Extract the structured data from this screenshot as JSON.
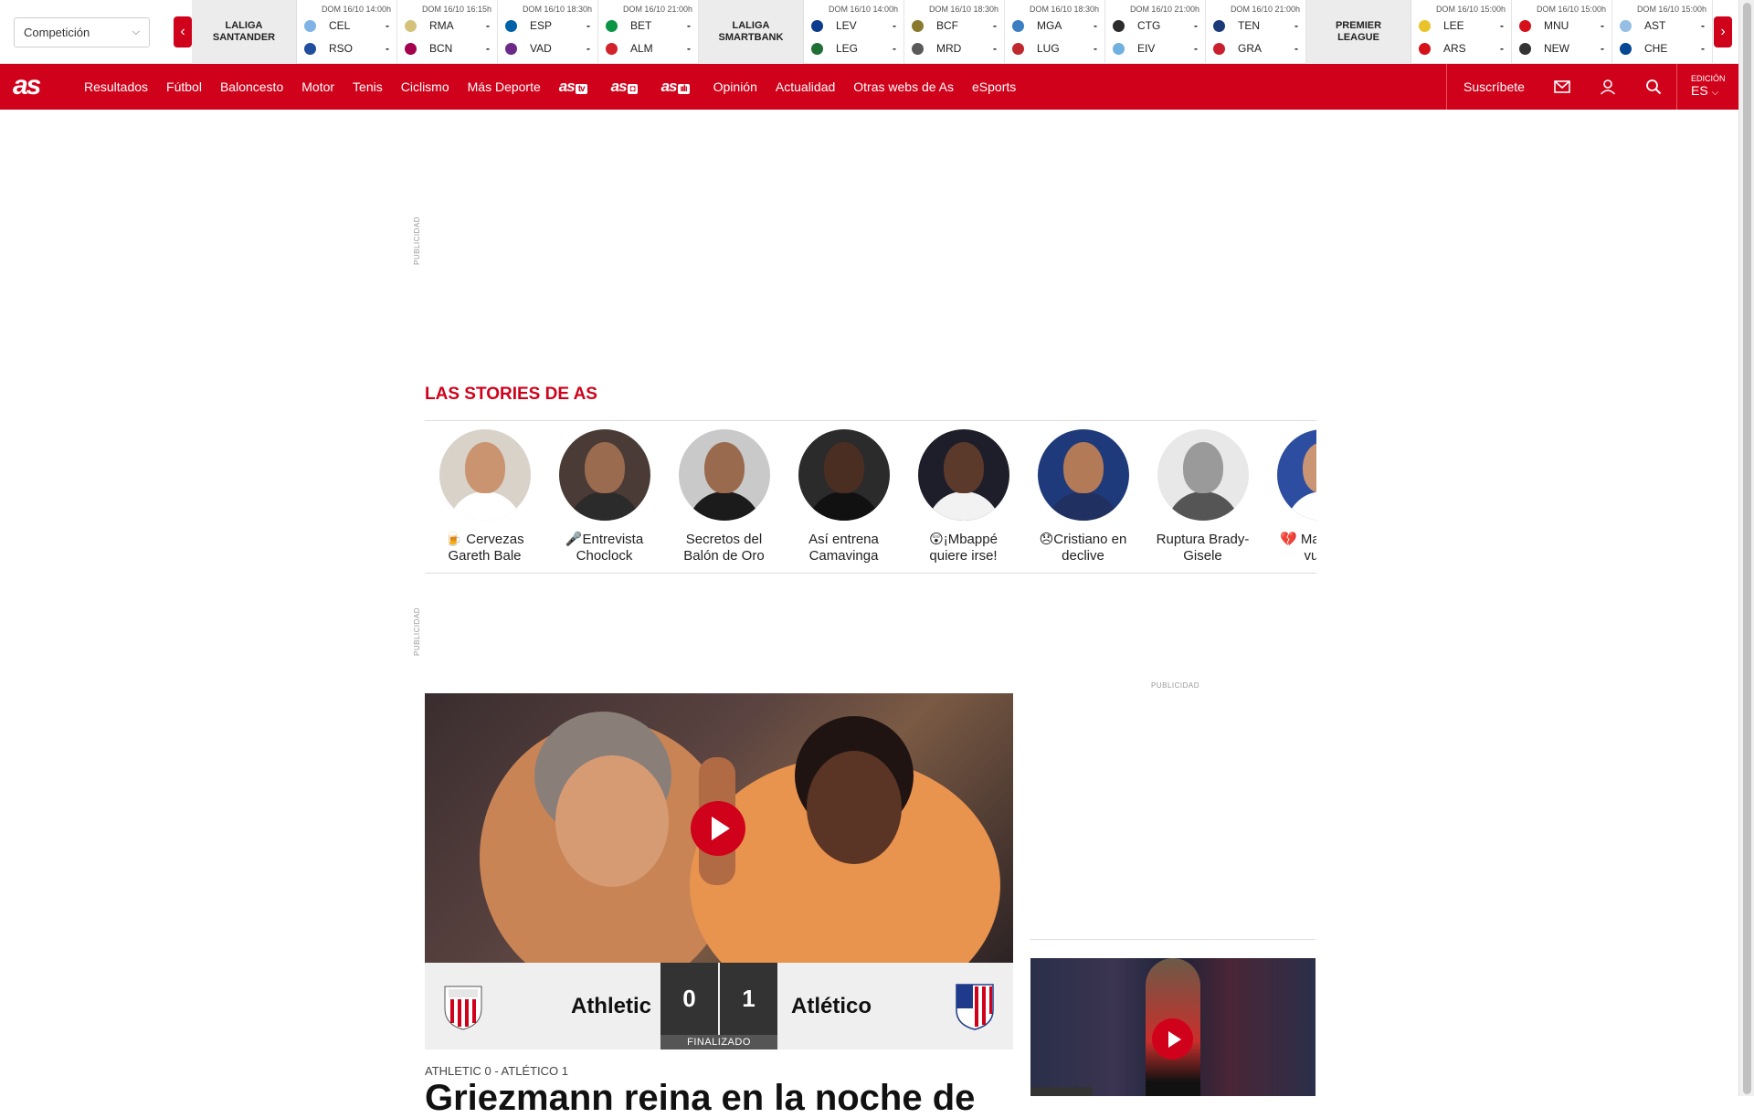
{
  "scores": {
    "competition_select": "Competición",
    "groups": [
      {
        "league": "LALIGA\nSANTANDER",
        "matches": [
          {
            "date": "DOM 16/10 14:00h",
            "home": "CEL",
            "away": "RSO",
            "home_score": "-",
            "away_score": "-",
            "home_color": "#7fb2e5",
            "away_color": "#1f4e9c"
          },
          {
            "date": "DOM 16/10 16:15h",
            "home": "RMA",
            "away": "BCN",
            "home_score": "-",
            "away_score": "-",
            "home_color": "#d4c27a",
            "away_color": "#a5004d"
          },
          {
            "date": "DOM 16/10 18:30h",
            "home": "ESP",
            "away": "VAD",
            "home_score": "-",
            "away_score": "-",
            "home_color": "#0060a8",
            "away_color": "#6b2a8a"
          },
          {
            "date": "DOM 16/10 21:00h",
            "home": "BET",
            "away": "ALM",
            "home_score": "-",
            "away_score": "-",
            "home_color": "#0b9444",
            "away_color": "#d2232a"
          }
        ]
      },
      {
        "league": "LALIGA\nSMARTBANK",
        "matches": [
          {
            "date": "DOM 16/10 14:00h",
            "home": "LEV",
            "away": "LEG",
            "home_score": "-",
            "away_score": "-",
            "home_color": "#0a3b8c",
            "away_color": "#1f6f35"
          },
          {
            "date": "DOM 16/10 18:30h",
            "home": "BCF",
            "away": "MRD",
            "home_score": "-",
            "away_score": "-",
            "home_color": "#8a7a2e",
            "away_color": "#5a5a5a"
          },
          {
            "date": "DOM 16/10 18:30h",
            "home": "MGA",
            "away": "LUG",
            "home_score": "-",
            "away_score": "-",
            "home_color": "#3b7ec2",
            "away_color": "#c0282f"
          },
          {
            "date": "DOM 16/10 21:00h",
            "home": "CTG",
            "away": "EIV",
            "home_score": "-",
            "away_score": "-",
            "home_color": "#2c2c2c",
            "away_color": "#6fb0e0"
          },
          {
            "date": "DOM 16/10 21:00h",
            "home": "TEN",
            "away": "GRA",
            "home_score": "-",
            "away_score": "-",
            "home_color": "#1c3a78",
            "away_color": "#c8202f"
          }
        ]
      },
      {
        "league": "PREMIER\nLEAGUE",
        "matches": [
          {
            "date": "DOM 16/10 15:00h",
            "home": "LEE",
            "away": "ARS",
            "home_score": "-",
            "away_score": "-",
            "home_color": "#e8c42a",
            "away_color": "#d6101a"
          },
          {
            "date": "DOM 16/10 15:00h",
            "home": "MNU",
            "away": "NEW",
            "home_score": "-",
            "away_score": "-",
            "home_color": "#d6101a",
            "away_color": "#333333"
          },
          {
            "date": "DOM 16/10 15:00h",
            "home": "AST",
            "away": "CHE",
            "home_score": "-",
            "away_score": "-",
            "home_color": "#95bfe5",
            "away_color": "#034694"
          }
        ]
      }
    ]
  },
  "nav": {
    "logo": "as",
    "items": [
      "Resultados",
      "Fútbol",
      "Baloncesto",
      "Motor",
      "Tenis",
      "Ciclismo",
      "Más Deporte"
    ],
    "brands": [
      {
        "name": "as",
        "tag": "tv"
      },
      {
        "name": "as",
        "tag": "◘"
      },
      {
        "name": "as",
        "tag": "ıılı"
      }
    ],
    "items2": [
      "Opinión",
      "Actualidad",
      "Otras webs de As",
      "eSports"
    ],
    "subscribe": "Suscríbete",
    "edition_label": "EDICIÓN",
    "edition_value": "ES"
  },
  "ads": {
    "label": "PUBLICIDAD"
  },
  "stories": {
    "title": "LAS STORIES DE AS",
    "items": [
      {
        "label": "🍺 Cervezas Gareth Bale",
        "skin": "#c9946f",
        "bg": "#d9d2c9",
        "shirt": "#ffffff"
      },
      {
        "label": "🎤Entrevista Choclock",
        "skin": "#9a6b4e",
        "bg": "#4a3b36",
        "shirt": "#2b2b2b"
      },
      {
        "label": "Secretos del Balón de Oro",
        "skin": "#9a6a4e",
        "bg": "#c9c9c9",
        "shirt": "#1b1b1b"
      },
      {
        "label": "Así entrena Camavinga",
        "skin": "#4b2e22",
        "bg": "#2b2b2b",
        "shirt": "#111111"
      },
      {
        "label": "😲¡Mbappé quiere irse!",
        "skin": "#5b3a2b",
        "bg": "#1e1e2a",
        "shirt": "#f2f2f2"
      },
      {
        "label": "😞Cristiano en declive",
        "skin": "#b37a58",
        "bg": "#1f3a7a",
        "shirt": "#203060"
      },
      {
        "label": "Ruptura Brady-Gisele",
        "skin": "#9a9a9a",
        "bg": "#e8e8e8",
        "shirt": "#555555"
      },
      {
        "label": "💔 Marcos ha vuelto",
        "skin": "#c99572",
        "bg": "#2d4ea0",
        "shirt": "#ffffff"
      }
    ]
  },
  "match": {
    "home": "Athletic",
    "away": "Atlético",
    "home_score": "0",
    "away_score": "1",
    "status": "FINALIZADO",
    "kicker": "ATHLETIC 0 - ATLÉTICO 1",
    "headline": "Griezmann reina en la noche de"
  },
  "colors": {
    "brand_red": "#d0021b",
    "score_box": "#333333"
  }
}
